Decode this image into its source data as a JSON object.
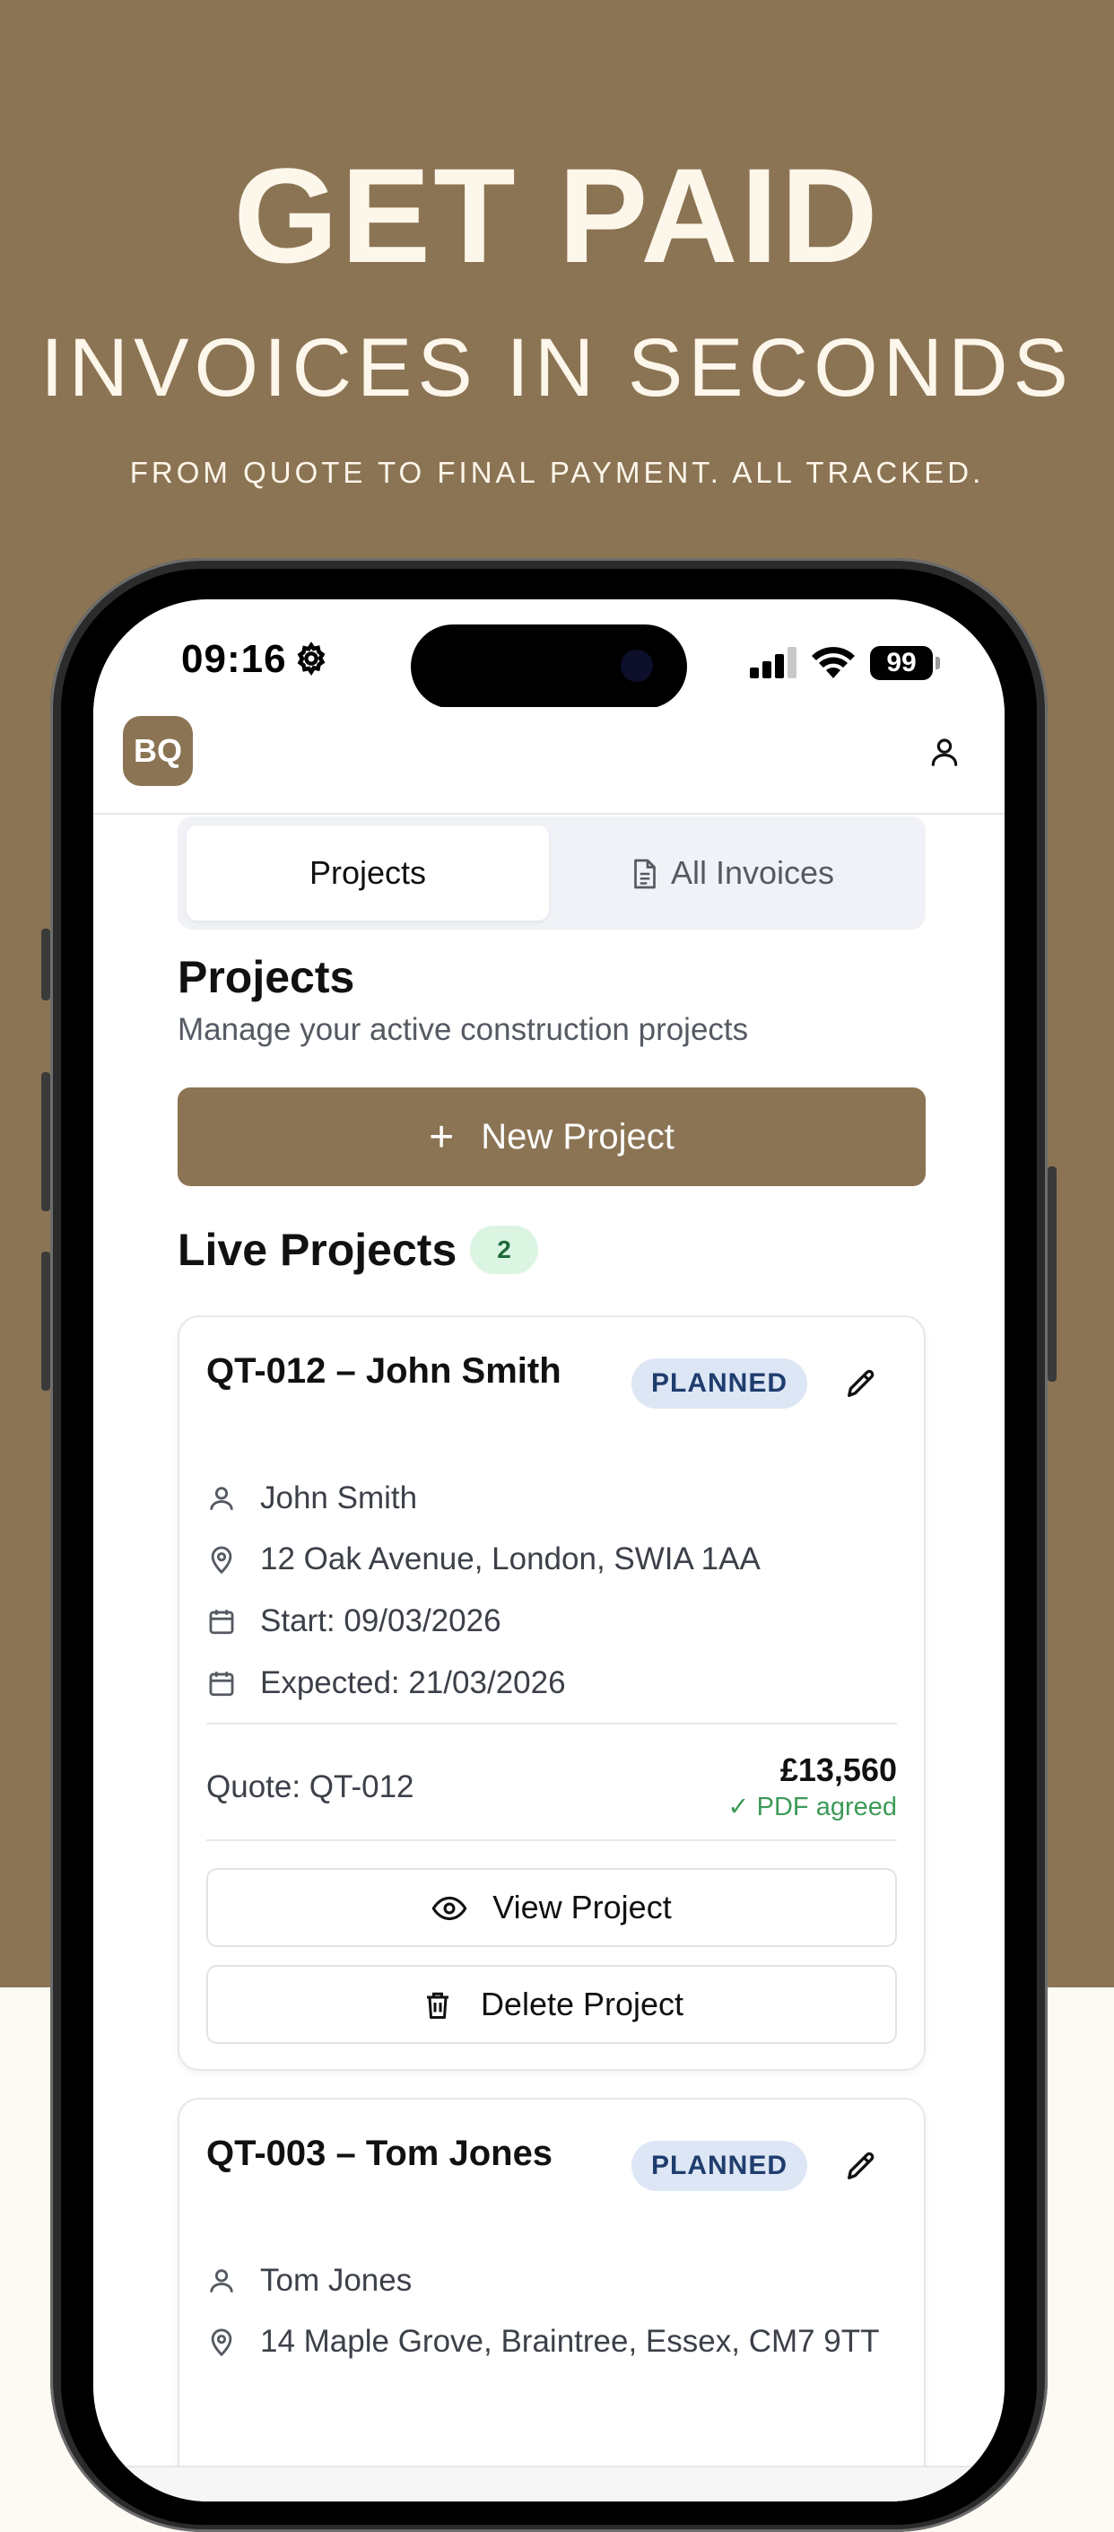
{
  "hero": {
    "title": "GET PAID",
    "subtitle": "INVOICES IN SECONDS",
    "tagline": "FROM QUOTE TO FINAL PAYMENT. ALL TRACKED."
  },
  "status_bar": {
    "time": "09:16",
    "battery": "99"
  },
  "header": {
    "logo_text": "BQ"
  },
  "tabs": [
    {
      "label": "Projects",
      "active": true
    },
    {
      "label": "All Invoices",
      "active": false
    }
  ],
  "page": {
    "title": "Projects",
    "subtitle": "Manage your active construction projects",
    "new_button": "New Project",
    "new_button_icon": "+",
    "section_title": "Live Projects",
    "section_count": "2"
  },
  "projects": [
    {
      "title": "QT-012 – John Smith",
      "status": "PLANNED",
      "client": "John Smith",
      "address": "12 Oak Avenue, London, SWIA 1AA",
      "start": "Start: 09/03/2026",
      "expected": "Expected: 21/03/2026",
      "quote": "Quote: QT-012",
      "amount": "£13,560",
      "pdf_status": "✓ PDF agreed",
      "view_label": "View Project",
      "delete_label": "Delete Project"
    },
    {
      "title": "QT-003 – Tom Jones",
      "status": "PLANNED",
      "client": "Tom Jones",
      "address": "14 Maple Grove, Braintree, Essex, CM7 9TT"
    }
  ],
  "colors": {
    "brand": "#8b7454",
    "planned_pill_bg": "#dde6f5",
    "count_badge_bg": "#dcf5e3",
    "pdf_agreed": "#3d9a57"
  }
}
